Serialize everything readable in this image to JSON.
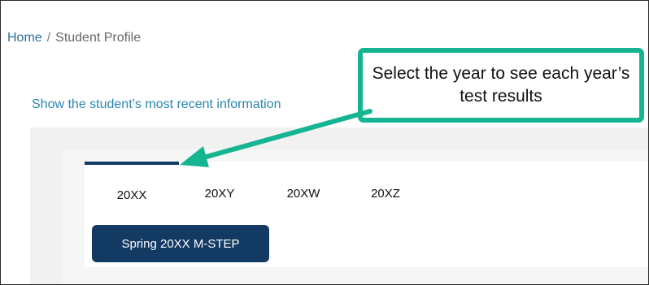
{
  "breadcrumb": {
    "home": "Home",
    "separator": "/",
    "current": "Student Profile"
  },
  "info_link": "Show the student’s most recent information",
  "tabs": [
    {
      "label": "20XX",
      "active": true
    },
    {
      "label": "20XY",
      "active": false
    },
    {
      "label": "20XW",
      "active": false
    },
    {
      "label": "20XZ",
      "active": false
    }
  ],
  "test_button": "Spring 20XX M-STEP",
  "callout": {
    "text": "Select the year to see each year’s test results"
  },
  "colors": {
    "accent": "#123a63",
    "link": "#2a86b0",
    "callout_border": "#16b592"
  }
}
